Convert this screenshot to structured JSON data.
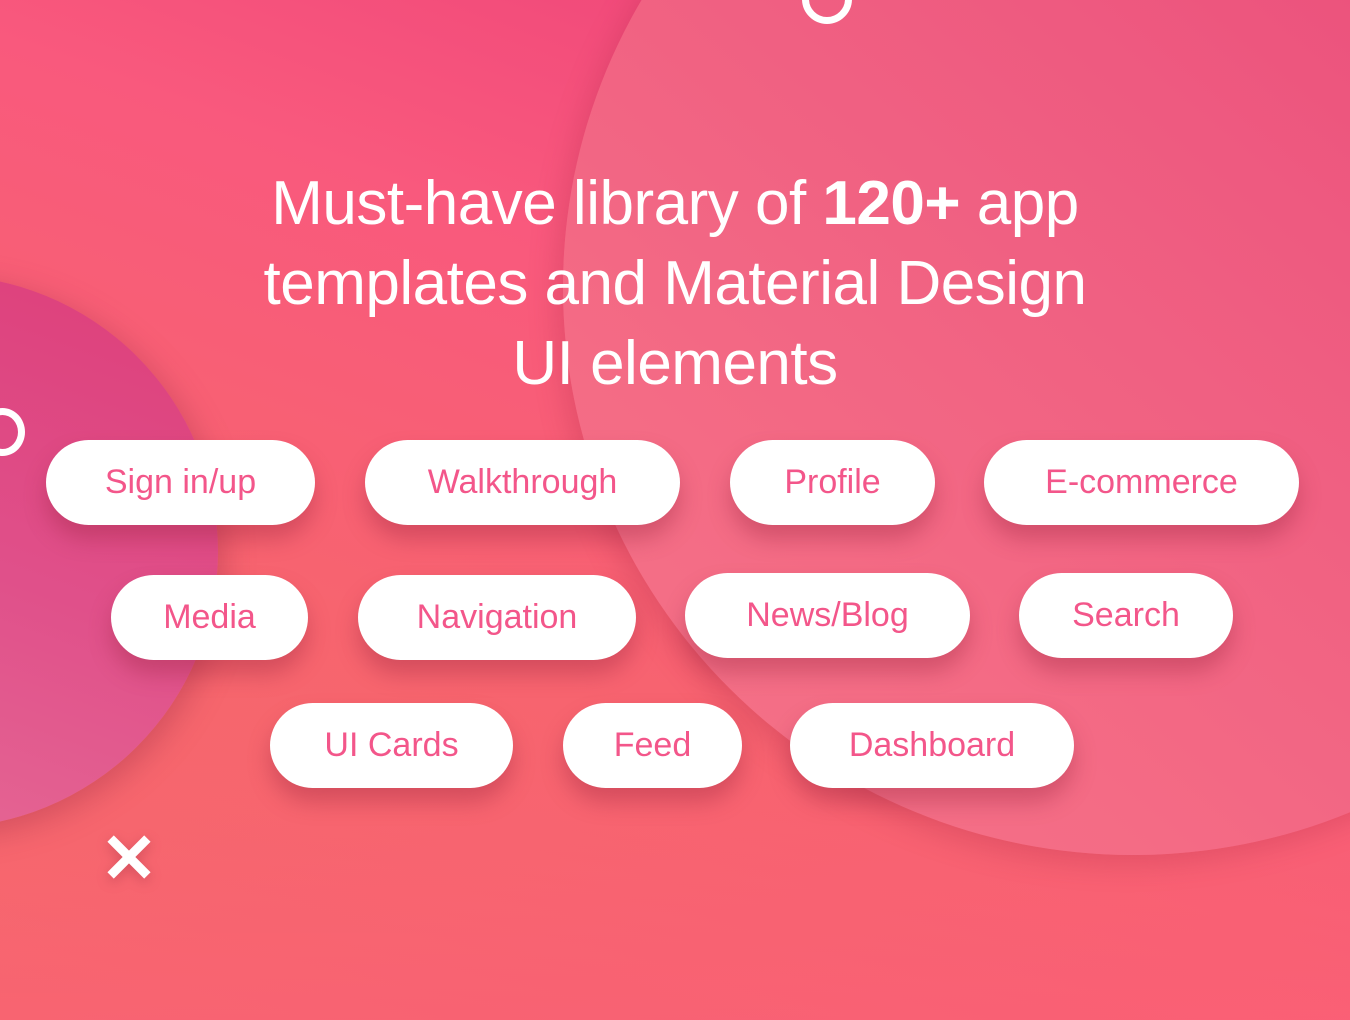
{
  "headline": {
    "line1_pre": "Must-have library of ",
    "line1_bold": "120+",
    "line1_post": " app",
    "line2": "templates and Material Design",
    "line3": "UI elements"
  },
  "categories": [
    {
      "label": "Sign in/up"
    },
    {
      "label": "Walkthrough"
    },
    {
      "label": "Profile"
    },
    {
      "label": "E-commerce"
    },
    {
      "label": "Media"
    },
    {
      "label": "Navigation"
    },
    {
      "label": "News/Blog"
    },
    {
      "label": "Search"
    },
    {
      "label": "UI Cards"
    },
    {
      "label": "Feed"
    },
    {
      "label": "Dashboard"
    }
  ],
  "decorations": {
    "ring_icon": "ring-icon",
    "close_icon": "x-icon"
  },
  "colors": {
    "accent_text": "#f3568a",
    "background_top_right": "#ea3d78",
    "background_bottom_left": "#f46c68",
    "pill_background": "#ffffff"
  }
}
